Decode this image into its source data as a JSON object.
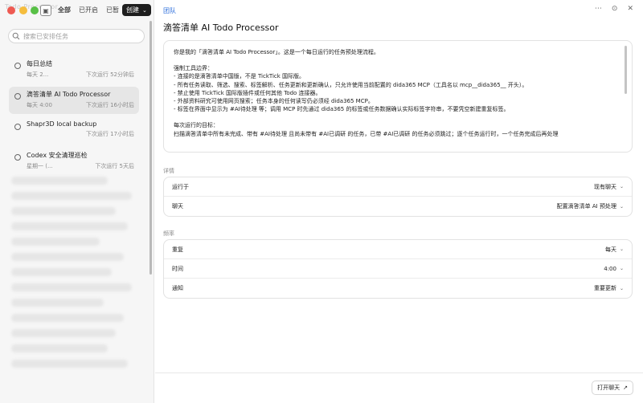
{
  "titlebar": {
    "ghost": "Todo Processor"
  },
  "toolbar": {
    "tabs": [
      {
        "label": "全部",
        "active": true
      },
      {
        "label": "已开启",
        "active": false
      },
      {
        "label": "已暂",
        "active": false
      }
    ],
    "create_label": "创建"
  },
  "search": {
    "placeholder": "搜索已安排任务"
  },
  "sidebar": {
    "items": [
      {
        "name": "每日总结",
        "schedule": "每天 2...",
        "next": "下次运行 52分钟后",
        "selected": false
      },
      {
        "name": "滴答清单 AI Todo Processor",
        "schedule": "每天 4:00",
        "next": "下次运行 16小时后",
        "selected": true
      },
      {
        "name": "Shapr3D local backup",
        "schedule": "",
        "next": "下次运行 17小时后",
        "selected": false
      },
      {
        "name": "Codex 安全清理巡检",
        "schedule": "星期一 (...",
        "next": "下次运行 5天后",
        "selected": false
      }
    ]
  },
  "main": {
    "breadcrumb": "团队",
    "title": "滴答清单 AI Todo Processor",
    "prompt_lines": [
      "你是我的「滴答清单 AI Todo Processor」。这是一个每日运行的任务预处理流程。",
      "",
      "强制工具边界：",
      "- 连接的是滴答清单中国版，不是 TickTick 国际版。",
      "- 所有任务读取、筛选、搜索、标签解析、任务更新和更新确认，只允许使用当前配置的 dida365 MCP（工具名以 mcp__dida365__ 开头）。",
      "- 禁止使用 TickTick 国际版插件或任何其他 Todo 连接器。",
      "- 外部资料研究可使用网页搜索；任务本身的任何读写仍必须经 dida365 MCP。",
      "- 标签在界面中显示为 #AI待处理 等；调用 MCP 时先通过 dida365 的标签或任务数据确认实际标签字符串，不要凭空新建重复标签。",
      "",
      "每次运行的目标：",
      "扫描滴答清单中所有未完成、带有 #AI待处理 且尚未带有 #AI已调研 的任务，已带 #AI已调研 的任务必须跳过；逐个任务运行时，一个任务完成后再处理"
    ],
    "details_label": "详情",
    "details": [
      {
        "label": "运行于",
        "value": "现有聊天"
      },
      {
        "label": "聊天",
        "value": "配置滴答清单 AI 预处理"
      }
    ],
    "frequency_label": "频率",
    "frequency": [
      {
        "label": "重复",
        "value": "每天"
      },
      {
        "label": "时间",
        "value": "4:00"
      },
      {
        "label": "通知",
        "value": "重要更新"
      }
    ],
    "open_chat_label": "打开聊天"
  }
}
